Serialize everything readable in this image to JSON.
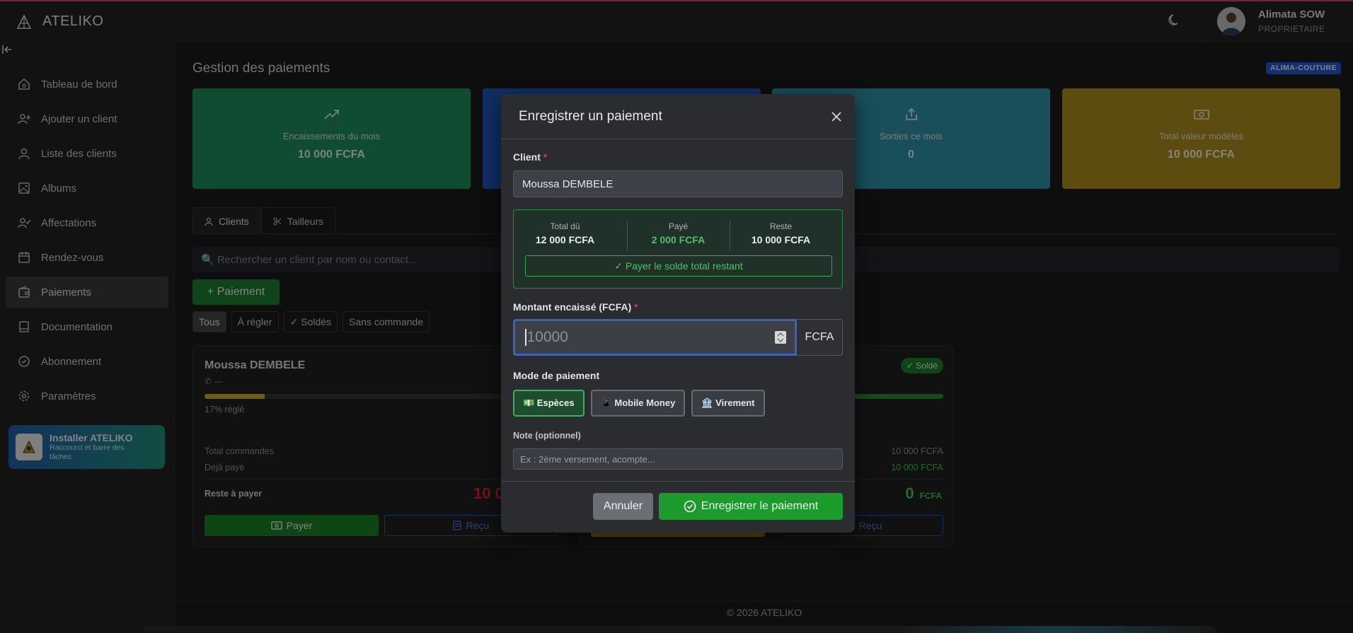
{
  "app": {
    "brand": "ATELIKO",
    "footer": "© 2026 ATELIKO"
  },
  "user": {
    "name": "Alimata SOW",
    "role": "PROPRIETAIRE"
  },
  "sidebar": {
    "items": [
      {
        "label": "Tableau de bord",
        "icon": "home-icon"
      },
      {
        "label": "Ajouter un client",
        "icon": "user-plus-icon"
      },
      {
        "label": "Liste des clients",
        "icon": "user-icon"
      },
      {
        "label": "Albums",
        "icon": "image-icon"
      },
      {
        "label": "Affectations",
        "icon": "user-check-icon"
      },
      {
        "label": "Rendez-vous",
        "icon": "calendar-icon"
      },
      {
        "label": "Paiements",
        "icon": "wallet-icon",
        "active": true
      },
      {
        "label": "Documentation",
        "icon": "book-icon"
      },
      {
        "label": "Abonnement",
        "icon": "badge-check-icon"
      },
      {
        "label": "Paramètres",
        "icon": "gear-icon"
      }
    ],
    "install": {
      "title": "Installer ATELIKO",
      "subtitle": "Raccourci et barre des tâches"
    }
  },
  "page": {
    "title": "Gestion des paiements",
    "org_badge": "ALIMA-COUTURE"
  },
  "stats": [
    {
      "label": "Encaissements du mois",
      "value": "10 000 FCFA",
      "color": "#1e8a5b"
    },
    {
      "label": "",
      "value": "",
      "color": "#1f54b8"
    },
    {
      "label": "Sorties ce mois",
      "value": "0",
      "color": "#2e8fa6"
    },
    {
      "label": "Total valeur modèles",
      "value": "10 000 FCFA",
      "color": "#a98a1d"
    }
  ],
  "tabs": [
    {
      "label": "Clients",
      "active": true
    },
    {
      "label": "Tailleurs"
    }
  ],
  "search": {
    "placeholder": "🔍 Rechercher un client par nom ou contact..."
  },
  "add_payment_label": "+ Paiement",
  "filters": [
    {
      "label": "Tous",
      "active": true
    },
    {
      "label": "À régler"
    },
    {
      "label": "✓ Soldés"
    },
    {
      "label": "Sans commande"
    }
  ],
  "cards": [
    {
      "name": "Moussa DEMBELE",
      "phone": "✆ —",
      "progress": 0.17,
      "progress_label": "17% réglé",
      "total_label": "Total commandes",
      "total_value": "",
      "paid_label": "Déjà payé",
      "paid_value": "",
      "rest_label": "Reste à payer",
      "rest_value": "10 0",
      "rest_unit": "",
      "pay_label": "Payer",
      "receipt_label": "Reçu",
      "bar_color": "#c9a91c",
      "rest_color": "#d3222e"
    },
    {
      "name": "",
      "phone": "",
      "progress": 1.0,
      "progress_label": "",
      "badge": "✓ Soldé",
      "total_label": "",
      "total_value": "10 000 FCFA",
      "paid_label": "",
      "paid_value": "10 000 FCFA",
      "rest_label": "",
      "rest_value": "0",
      "rest_unit": "FCFA",
      "pay_label": "",
      "receipt_label": "Reçu",
      "bar_color": "#1f8f2d",
      "rest_color": "#3fbf55"
    }
  ],
  "modal": {
    "title": "Enregistrer un paiement",
    "client_label": "Client",
    "client_value": "Moussa DEMBELE",
    "summary": {
      "total_label": "Total dû",
      "total_value": "12 000 FCFA",
      "paid_label": "Payé",
      "paid_value": "2 000 FCFA",
      "rest_label": "Reste",
      "rest_value": "10 000 FCFA",
      "pay_all_label": "✓ Payer le solde total restant"
    },
    "amount_label": "Montant encaissé (FCFA)",
    "amount_value": "10000",
    "amount_unit": "FCFA",
    "mode_label": "Mode de paiement",
    "modes": [
      {
        "label": "💵 Espèces",
        "active": true
      },
      {
        "label": "📱 Mobile Money"
      },
      {
        "label": "🏦 Virement"
      }
    ],
    "note_label": "Note (optionnel)",
    "note_placeholder": "Ex : 2ème versement, acompte...",
    "cancel_label": "Annuler",
    "save_label": "Enregistrer le paiement"
  }
}
